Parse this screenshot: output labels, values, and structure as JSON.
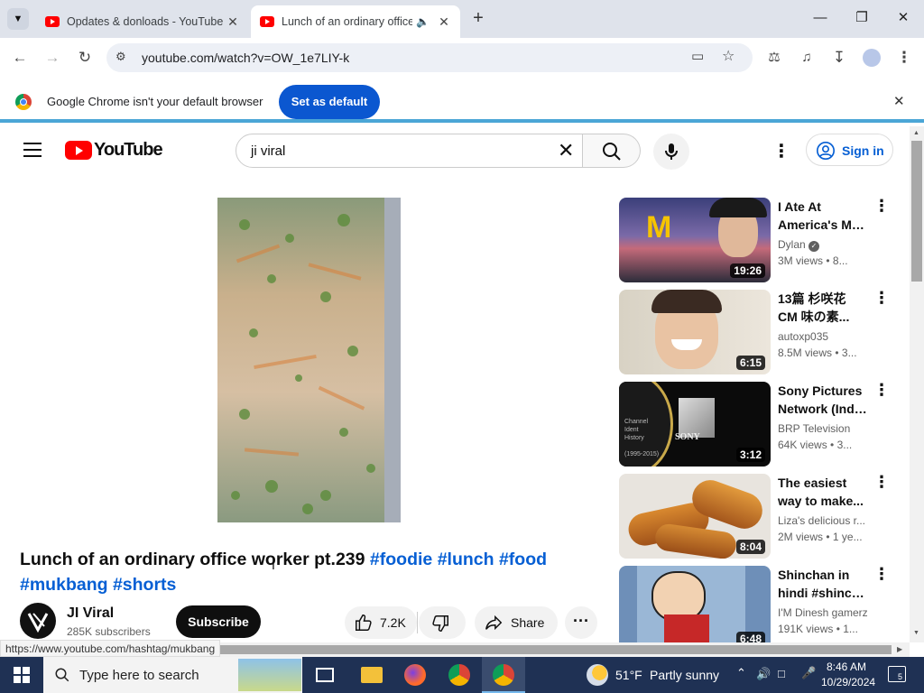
{
  "browser": {
    "tabs": [
      {
        "title": "Opdates & donloads - YouTube",
        "active": false
      },
      {
        "title": "Lunch of an ordinary office",
        "active": true
      }
    ],
    "new_tab_icon": "plus-icon",
    "url": "youtube.com/watch?v=OW_1e7LIY-k",
    "infobar": {
      "message": "Google Chrome isn't your default browser",
      "button": "Set as default"
    },
    "status_url": "https://www.youtube.com/hashtag/mukbang"
  },
  "youtube": {
    "logo_text": "YouTube",
    "search_value": "ji viral",
    "sign_in": "Sign in",
    "video": {
      "title_plain": "Lunch of an ordinary office worker pt.239",
      "hashtags_line1": [
        "#foodie",
        "#lunch",
        "#food"
      ],
      "hashtags_line2": [
        "#mukbang",
        "#shorts"
      ],
      "channel": "JI Viral",
      "subscribers": "285K subscribers",
      "subscribe": "Subscribe",
      "likes": "7.2K",
      "share": "Share"
    },
    "recommendations": [
      {
        "title1": "I Ate At",
        "title2": "America's Mo...",
        "channel": "Dylan",
        "verified": true,
        "views": "3M views",
        "age": "8...",
        "duration": "19:26"
      },
      {
        "title1": "13篇 杉咲花",
        "title2": "CM 味の素...",
        "channel": "autoxp035",
        "verified": false,
        "views": "8.5M views",
        "age": "3...",
        "duration": "6:15"
      },
      {
        "title1": "Sony Pictures",
        "title2": "Network (Indi...",
        "channel": "BRP Television",
        "verified": false,
        "views": "64K views",
        "age": "3...",
        "duration": "3:12"
      },
      {
        "title1": "The easiest",
        "title2": "way to make...",
        "channel": "Liza's delicious r...",
        "verified": false,
        "views": "2M views",
        "age": "1 ye...",
        "duration": "8:04"
      },
      {
        "title1": "Shinchan in",
        "title2": "hindi #shinch...",
        "channel": "I'M Dinesh gamerz",
        "verified": false,
        "views": "191K views",
        "age": "1...",
        "duration": "6:48"
      }
    ]
  },
  "taskbar": {
    "search_placeholder": "Type here to search",
    "weather_temp": "51°F",
    "weather_desc": "Partly sunny",
    "time": "8:46 AM",
    "date": "10/29/2024",
    "notification_count": "5"
  }
}
